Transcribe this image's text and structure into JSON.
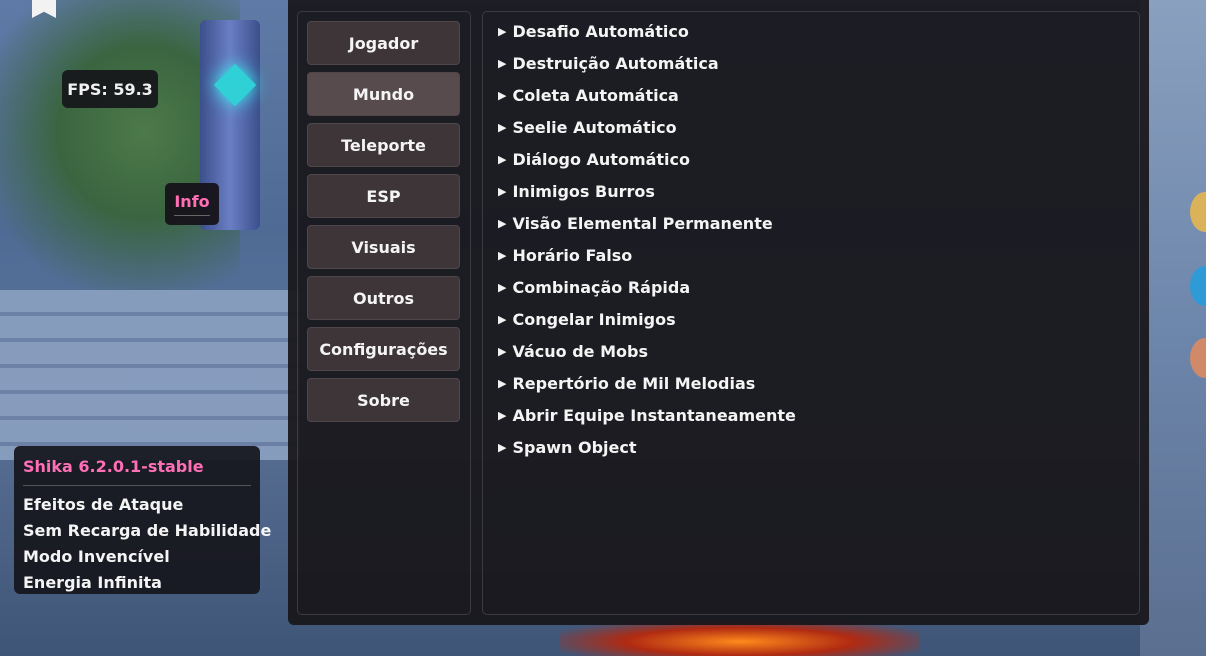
{
  "overlay": {
    "fps_text": "FPS: 59.3",
    "info_label": "Info"
  },
  "status": {
    "version": "Shika 6.2.0.1-stable",
    "active_features": [
      "Efeitos de Ataque",
      "Sem Recarga de Habilidade",
      "Modo Invencível",
      "Energia Infinita"
    ]
  },
  "sidebar": {
    "items": [
      {
        "label": "Jogador",
        "active": false
      },
      {
        "label": "Mundo",
        "active": true
      },
      {
        "label": "Teleporte",
        "active": false
      },
      {
        "label": "ESP",
        "active": false
      },
      {
        "label": "Visuais",
        "active": false
      },
      {
        "label": "Outros",
        "active": false
      },
      {
        "label": "Configurações",
        "active": false
      },
      {
        "label": "Sobre",
        "active": false
      }
    ]
  },
  "content": {
    "arrow_icon": "triangle-right-icon",
    "features": [
      "Desafio Automático",
      "Destruição Automática",
      "Coleta Automática",
      "Seelie Automático",
      "Diálogo Automático",
      "Inimigos Burros",
      "Visão Elemental Permanente",
      "Horário Falso",
      "Combinação Rápida",
      "Congelar Inimigos",
      "Vácuo de Mobs",
      "Repertório de Mil Melodias",
      "Abrir Equipe Instantaneamente",
      "Spawn Object"
    ]
  },
  "colors": {
    "accent": "#ff6fb5",
    "panel_bg": "#18161a",
    "button_bg": "#3d3538",
    "button_active_bg": "#574b4e"
  }
}
